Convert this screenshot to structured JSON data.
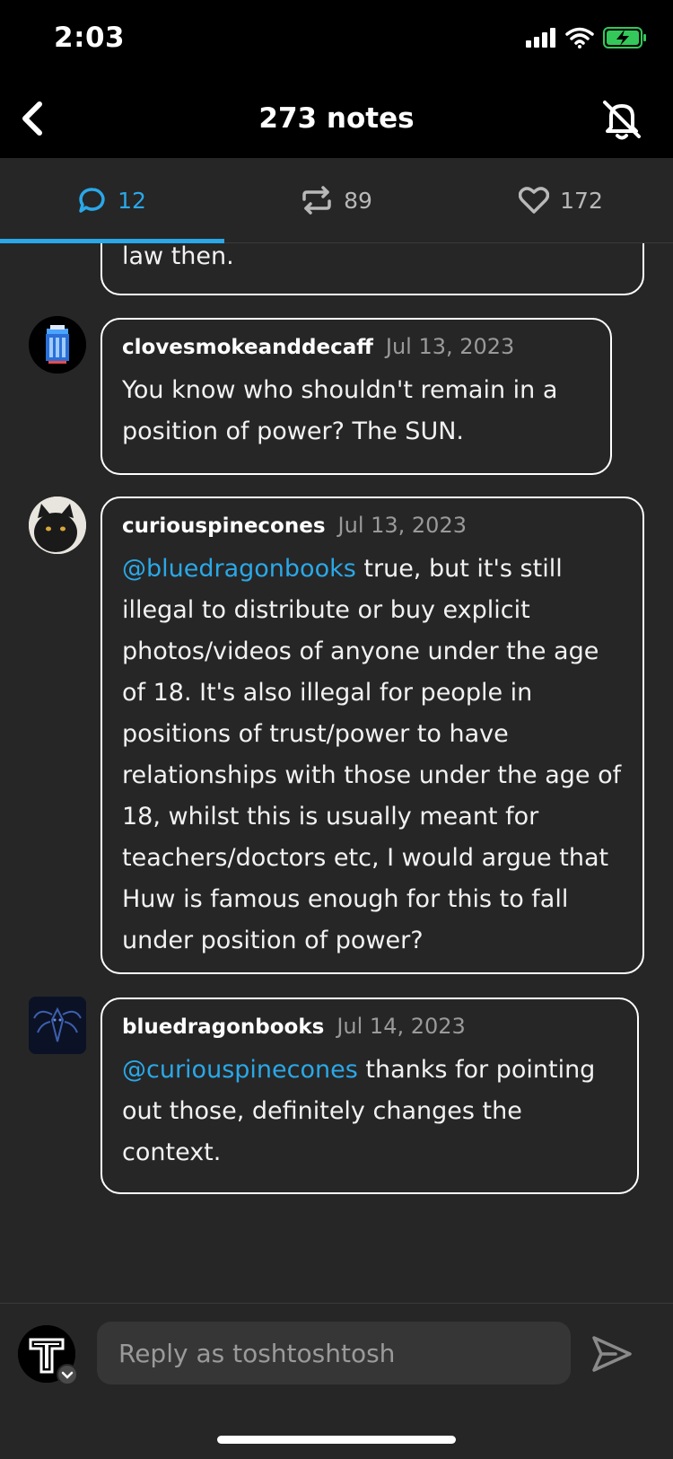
{
  "status_bar": {
    "time": "2:03"
  },
  "header": {
    "title": "273 notes"
  },
  "tabs": [
    {
      "label": "12",
      "icon": "comment-icon"
    },
    {
      "label": "89",
      "icon": "reblog-icon"
    },
    {
      "label": "172",
      "icon": "heart-icon"
    }
  ],
  "comments": [
    {
      "body": "law then."
    },
    {
      "user": "clovesmokeanddecaff",
      "date": "Jul 13, 2023",
      "body": "You know who shouldn't remain in a position of power? The SUN."
    },
    {
      "user": "curiouspinecones",
      "date": "Jul 13, 2023",
      "mention": "@bluedragonbooks",
      "body": " true, but it's still illegal to distribute or buy explicit photos/videos of anyone under the age of 18. It's also illegal for people in positions of trust/power to have relationships with those under the age of 18, whilst this is usually meant for teachers/doctors etc, I would argue that Huw is famous enough for this to fall under position of power?"
    },
    {
      "user": "bluedragonbooks",
      "date": "Jul 14, 2023",
      "mention": "@curiouspinecones",
      "body": " thanks for pointing out those, definitely changes the context."
    }
  ],
  "reply": {
    "placeholder": "Reply as toshtoshtosh"
  },
  "colors": {
    "accent": "#2aa8e8",
    "background": "#262626",
    "header": "#000000"
  }
}
